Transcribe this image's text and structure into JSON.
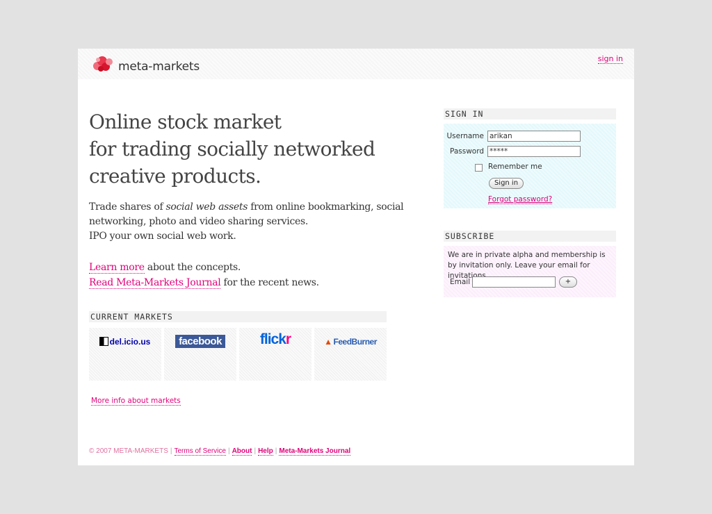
{
  "header": {
    "logo_text": "meta-markets",
    "sign_in_link": "sign in"
  },
  "headline": {
    "line1": "Online stock market",
    "line2": "for trading socially networked",
    "line3": "creative products."
  },
  "intro": {
    "part1": "Trade shares of ",
    "emphasis": "social web assets",
    "part2": " from online bookmarking, social networking, photo and video sharing services.",
    "line2": "IPO your own social web work."
  },
  "links": {
    "learn_more": "Learn more",
    "learn_more_suffix": " about the concepts.",
    "journal": "Read Meta-Markets Journal",
    "journal_suffix": " for the recent news."
  },
  "markets": {
    "title": "CURRENT MARKETS",
    "items": [
      {
        "name": "del.icio.us"
      },
      {
        "name": "facebook"
      },
      {
        "name": "flickr"
      },
      {
        "name": "FeedBurner"
      }
    ],
    "more_info": "More info about markets"
  },
  "signin": {
    "title": "SIGN IN",
    "username_label": "Username",
    "username_value": "arikan",
    "password_label": "Password",
    "password_value": "*****",
    "remember_label": "Remember me",
    "button": "Sign in",
    "forgot": "Forgot password?"
  },
  "subscribe": {
    "title": "SUBSCRIBE",
    "text": "We are in private alpha and membership is by invitation only. Leave your email for invitations.",
    "email_label": "Email",
    "email_value": "",
    "button": "+"
  },
  "footer": {
    "copyright": "© 2007 META-MARKETS",
    "terms": "Terms of Service",
    "about": "About",
    "help": "Help",
    "journal": "Meta-Markets Journal"
  },
  "colors": {
    "accent": "#e0007a",
    "signin_bg": "#e4f8fb",
    "subscribe_bg": "#fbeefb",
    "facebook": "#3b5998",
    "flickr_blue": "#0063dc",
    "flickr_pink": "#ff0084"
  }
}
